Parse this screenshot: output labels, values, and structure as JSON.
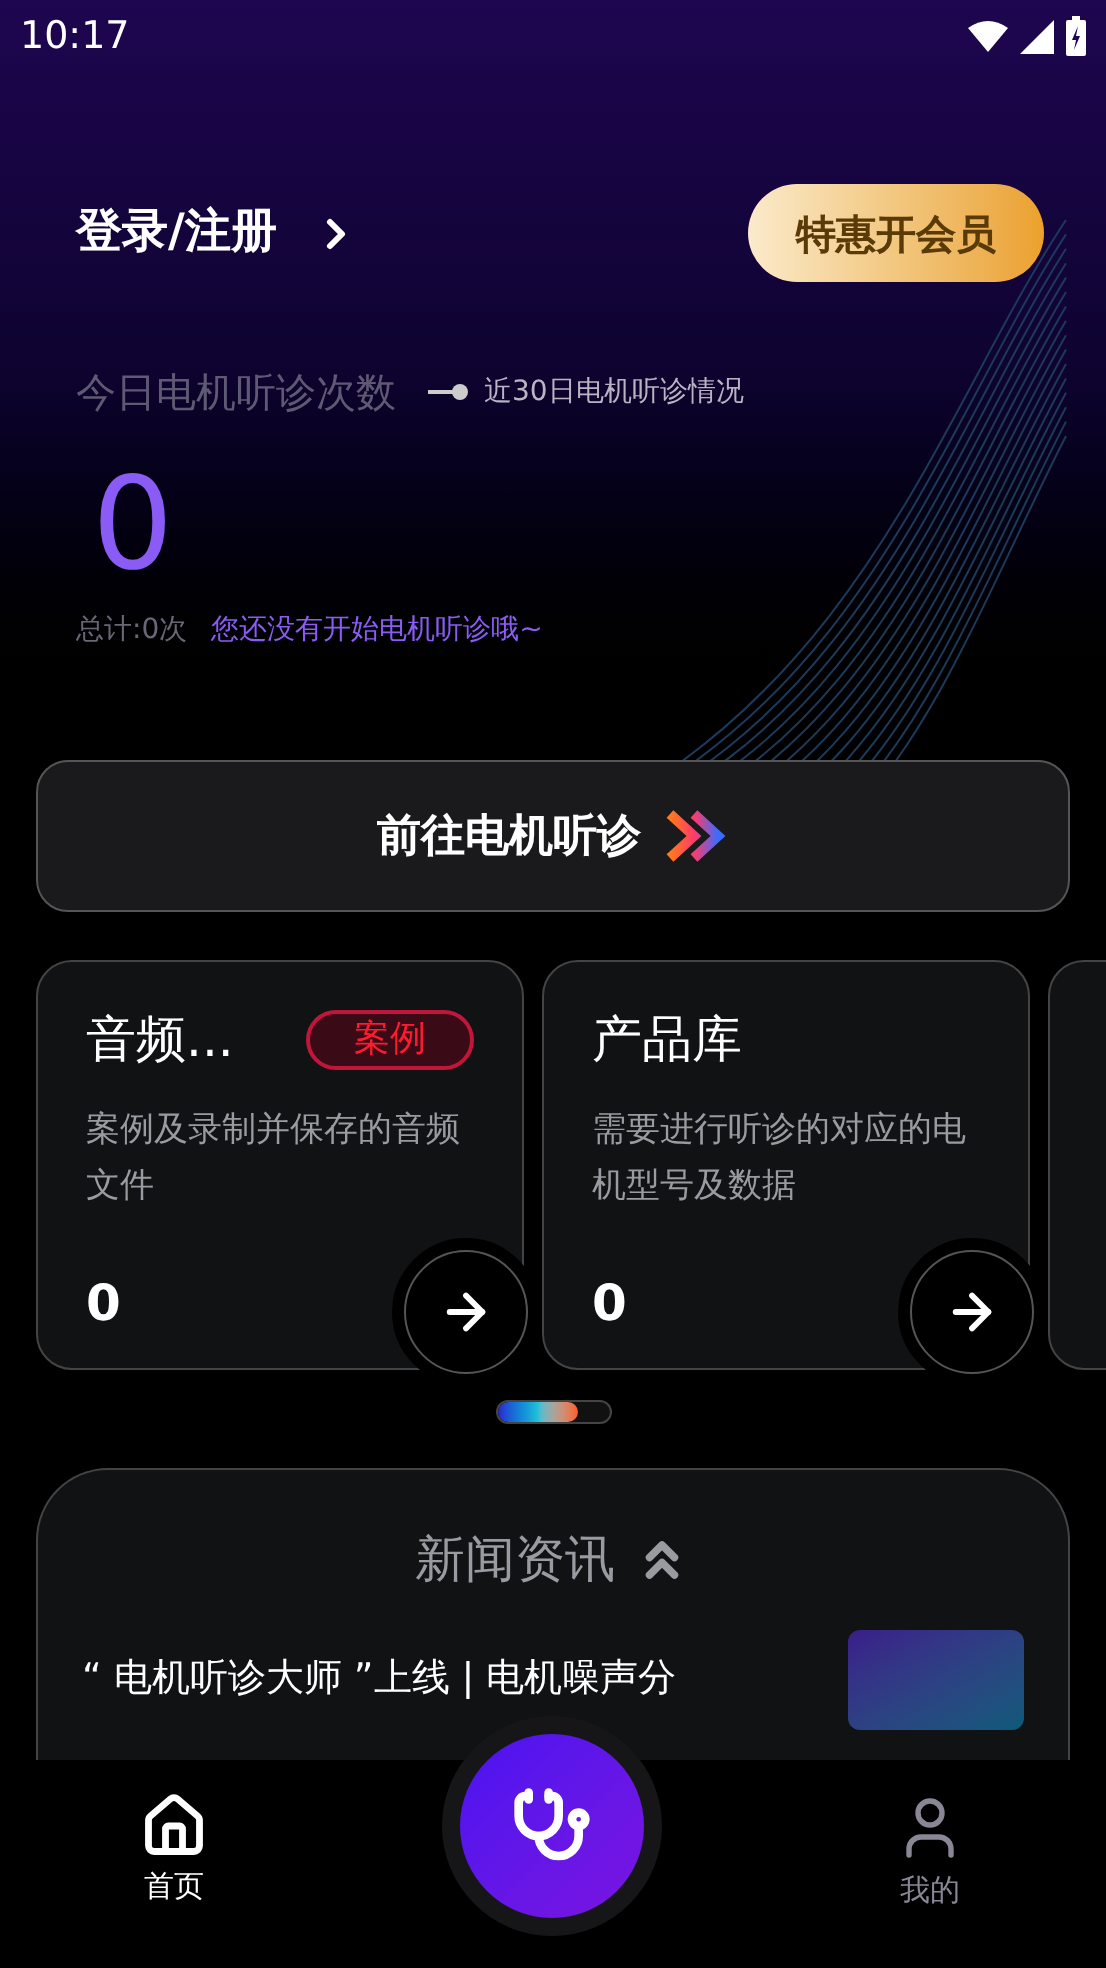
{
  "status_bar": {
    "time": "10:17"
  },
  "header": {
    "login": "登录/注册",
    "vip_button": "特惠开会员",
    "today_label": "今日电机听诊次数",
    "trend_link": "近30日电机听诊情况",
    "count": "0",
    "total": "总计:0次",
    "hint": "您还没有开始电机听诊哦~"
  },
  "start_button": "前往电机听诊",
  "modules": [
    {
      "title": "音频...",
      "badge": "案例",
      "description": "案例及录制并保存的音频文件",
      "count": "0"
    },
    {
      "title": "产品库",
      "description": "需要进行听诊的对应的电机型号及数据",
      "count": "0"
    }
  ],
  "news": {
    "title": "新闻资讯",
    "items": [
      {
        "title": "“ 电机听诊大师 ”上线 | 电机噪声分"
      }
    ]
  },
  "nav": [
    {
      "kind": "home",
      "label": "首页",
      "selected": true
    },
    {
      "kind": "fab"
    },
    {
      "kind": "profile",
      "label": "我的",
      "selected": false
    }
  ]
}
